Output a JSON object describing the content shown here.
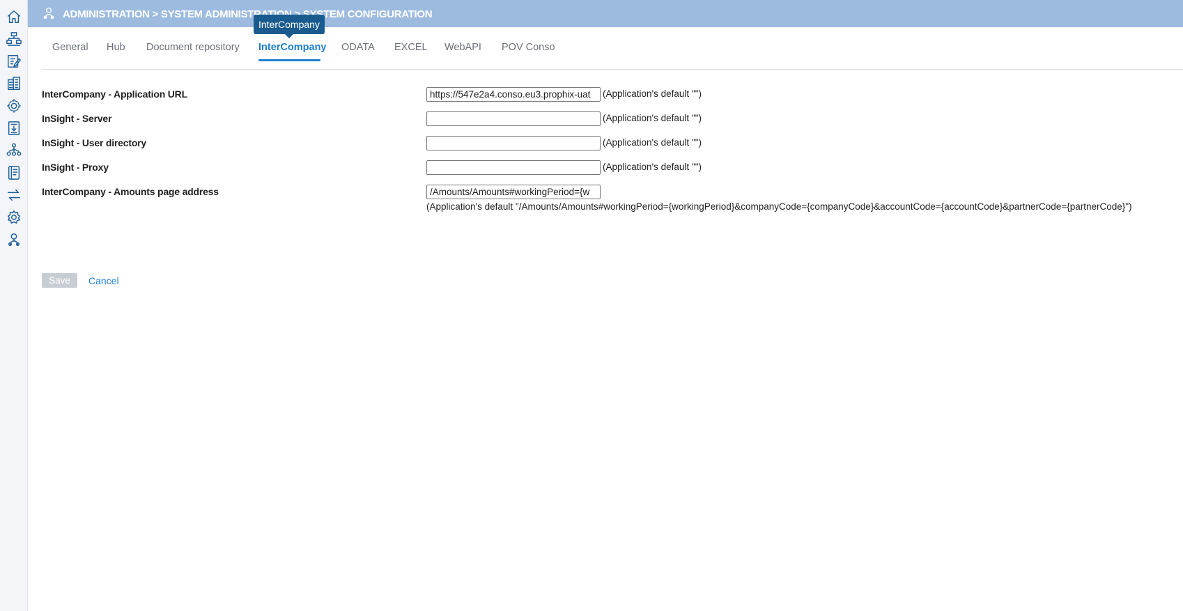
{
  "sidebar": {
    "icons": [
      "home-icon",
      "workflow-icon",
      "edit-form-icon",
      "buildings-icon",
      "network-gear-icon",
      "import-document-icon",
      "hierarchy-icon",
      "ledger-icon",
      "transfer-arrows-icon",
      "settings-gear-icon",
      "administration-icon"
    ]
  },
  "header": {
    "icon": "administration-icon",
    "title": "ADMINISTRATION > SYSTEM ADMINISTRATION > SYSTEM CONFIGURATION"
  },
  "tabs": [
    {
      "label": "General"
    },
    {
      "label": "Hub"
    },
    {
      "label": "Document repository"
    },
    {
      "label": "InterCompany",
      "active": true
    },
    {
      "label": "ODATA"
    },
    {
      "label": "EXCEL"
    },
    {
      "label": "WebAPI"
    },
    {
      "label": "POV Conso"
    }
  ],
  "tooltip": {
    "text": "InterCompany"
  },
  "fields": [
    {
      "label": "InterCompany - Application URL",
      "value": "https://547e2a4.conso.eu3.prophix-uat",
      "default": "(Application's default \"\")"
    },
    {
      "label": "InSight - Server",
      "value": "",
      "default": "(Application's default \"\")"
    },
    {
      "label": "InSight - User directory",
      "value": "",
      "default": "(Application's default \"\")"
    },
    {
      "label": "InSight - Proxy",
      "value": "",
      "default": "(Application's default \"\")"
    },
    {
      "label": "InterCompany - Amounts page address",
      "value": "/Amounts/Amounts#workingPeriod={w",
      "default": "(Application's default \"/Amounts/Amounts#workingPeriod={workingPeriod}&companyCode={companyCode}&accountCode={accountCode}&partnerCode={partnerCode}\")"
    }
  ],
  "actions": {
    "save_label": "Save",
    "cancel_label": "Cancel"
  },
  "colors": {
    "header": "#9dbbdf",
    "accent": "#1d7fd0",
    "tooltip": "#1a5b8f",
    "sidebar_icon": "#1f5f9a"
  }
}
